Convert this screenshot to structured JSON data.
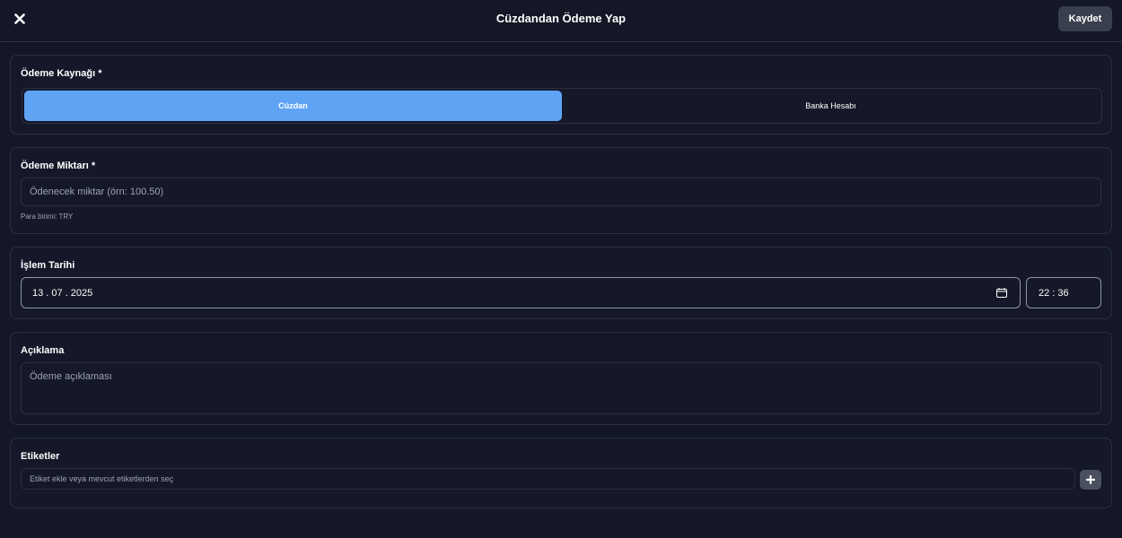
{
  "header": {
    "close_icon": "×",
    "title": "Cüzdandan Ödeme Yap",
    "save_label": "Kaydet"
  },
  "payment_source": {
    "label": "Ödeme Kaynağı *",
    "options": [
      "Cüzdan",
      "Banka Hesabı"
    ],
    "selected": "Cüzdan"
  },
  "amount": {
    "label": "Ödeme Miktarı *",
    "placeholder": "Ödenecek miktar (örn: 100.50)",
    "value": "",
    "helper": "Para birimi: TRY"
  },
  "date": {
    "label": "İşlem Tarihi",
    "date_value": "13 . 07 . 2025",
    "time_value": "22 : 36"
  },
  "description": {
    "label": "Açıklama",
    "placeholder": "Ödeme açıklaması",
    "value": ""
  },
  "tags": {
    "label": "Etiketler",
    "placeholder": "Etiket ekle veya mevcut etiketlerden seç",
    "add_label": "+"
  },
  "colors": {
    "background": "#131726",
    "accent": "#5fa3f5",
    "border": "#2b3040"
  }
}
